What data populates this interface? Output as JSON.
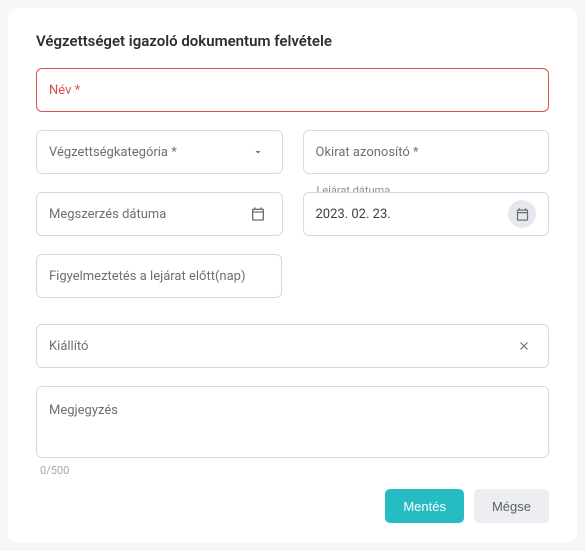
{
  "title": "Végzettséget igazoló dokumentum felvétele",
  "fields": {
    "name": {
      "label": "Név *"
    },
    "category": {
      "label": "Végzettségkategória *"
    },
    "docId": {
      "label": "Okirat azonosító *"
    },
    "obtainDate": {
      "label": "Megszerzés dátuma"
    },
    "expiryDate": {
      "float": "Lejárat dátuma",
      "value": "2023. 02. 23."
    },
    "warnDays": {
      "label": "Figyelmeztetés a lejárat előtt(nap)"
    },
    "issuer": {
      "label": "Kiállító"
    },
    "note": {
      "label": "Megjegyzés",
      "counter": "0/500"
    }
  },
  "actions": {
    "save": "Mentés",
    "cancel": "Mégse"
  }
}
